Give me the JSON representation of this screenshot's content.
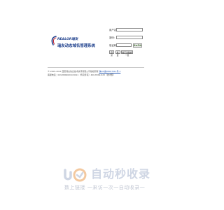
{
  "logo": {
    "brand_en": "REALOR瑞友",
    "brand_cn": "瑞友动态域名管理系统"
  },
  "login": {
    "username_label": "用户名:",
    "password_label": "密码:",
    "captcha_label": "验证码:",
    "username_value": "",
    "password_value": "",
    "captcha_value": "",
    "captcha_code": "0x2b",
    "login_button": "登 录",
    "reset_button": "重 置",
    "change_captcha_button": "看不清楚换一张"
  },
  "footer": {
    "copyright": "© 2005-2021 西安瑞友信息技术资讯有限公司版权所有",
    "icp": "陕ICP备05007011号-1",
    "phone_text": "客服电话：029-88496210-8011（传真传真）400-8349-020（技术部）"
  },
  "watermark": {
    "title": "自动秒收录",
    "subtitle": "数上链接 一来访一次一自动收录一"
  },
  "colors": {
    "brand": "#1d3f8c",
    "link": "#2154b0",
    "watermark": "#cfd6e4"
  }
}
